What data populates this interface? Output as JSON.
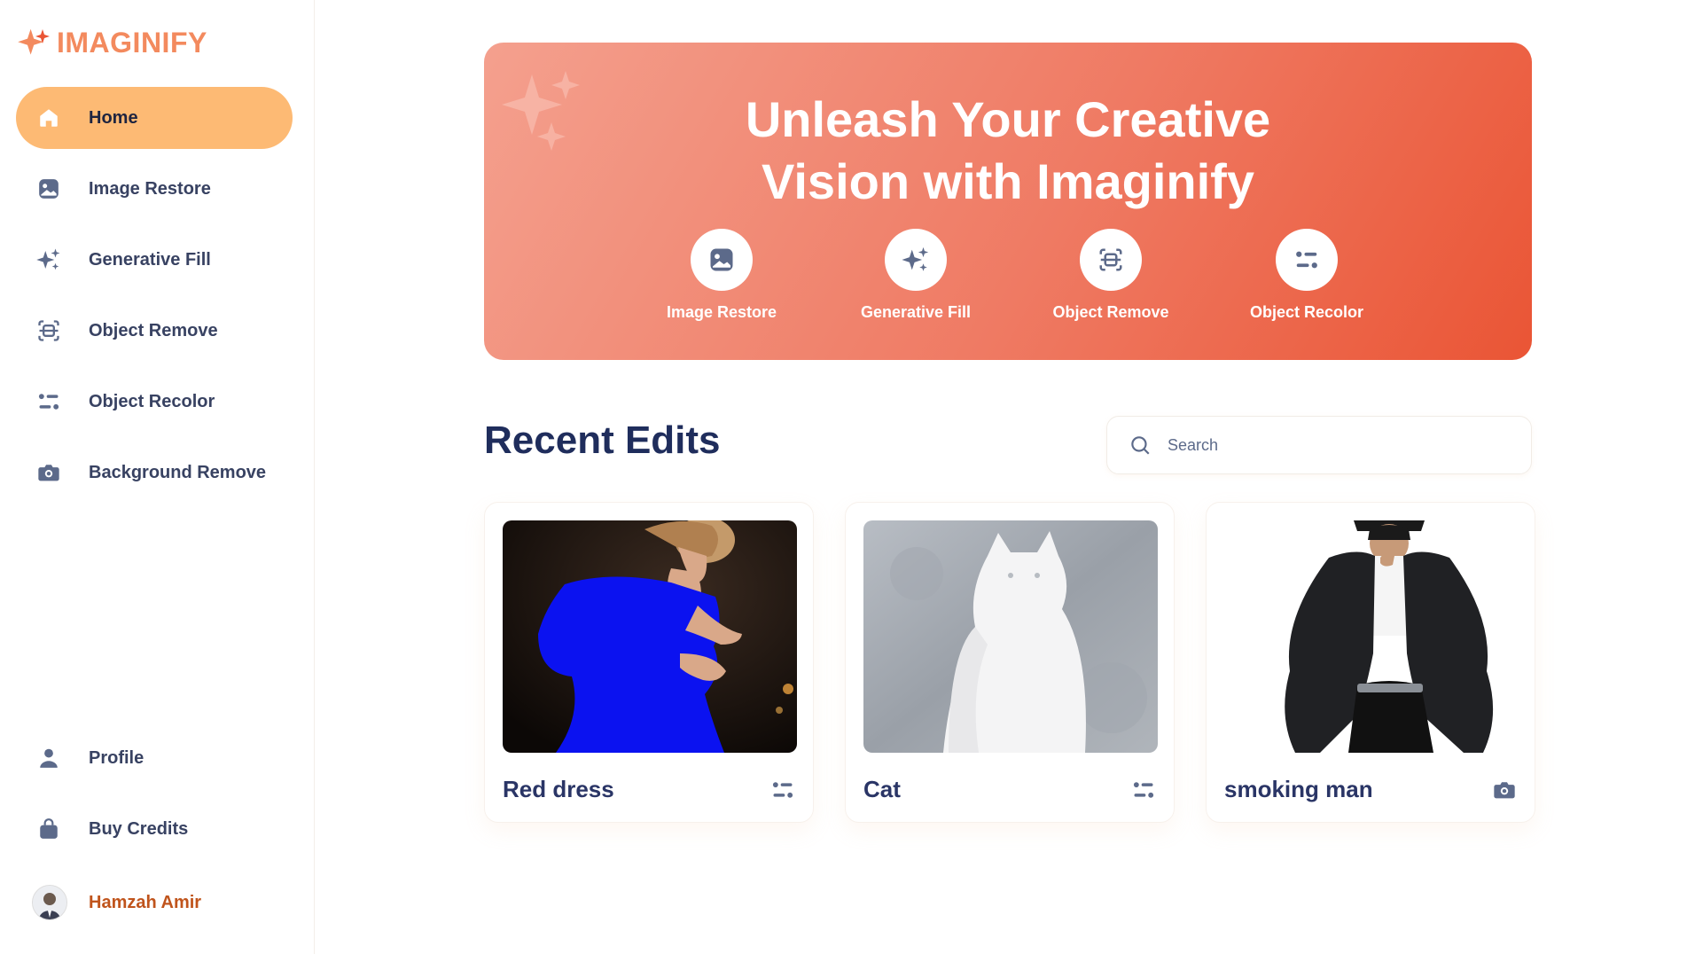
{
  "app": {
    "name": "IMAGINIFY",
    "brand_color": "#F38A5E",
    "accent_color": "#FDBA74"
  },
  "sidebar": {
    "items": [
      {
        "label": "Home",
        "icon": "home-icon",
        "active": true
      },
      {
        "label": "Image Restore",
        "icon": "image-icon"
      },
      {
        "label": "Generative Fill",
        "icon": "stars-icon"
      },
      {
        "label": "Object Remove",
        "icon": "scan-icon"
      },
      {
        "label": "Object Recolor",
        "icon": "filter-icon"
      },
      {
        "label": "Background Remove",
        "icon": "camera-icon"
      }
    ],
    "bottom_items": [
      {
        "label": "Profile",
        "icon": "user-icon"
      },
      {
        "label": "Buy Credits",
        "icon": "bag-icon"
      }
    ],
    "user": {
      "name": "Hamzah Amir"
    }
  },
  "hero": {
    "title": "Unleash Your Creative\nVision with Imaginify",
    "actions": [
      {
        "label": "Image Restore",
        "icon": "image-icon"
      },
      {
        "label": "Generative Fill",
        "icon": "stars-icon"
      },
      {
        "label": "Object Remove",
        "icon": "scan-icon"
      },
      {
        "label": "Object Recolor",
        "icon": "filter-icon"
      }
    ]
  },
  "recent": {
    "title": "Recent Edits",
    "search_placeholder": "Search",
    "cards": [
      {
        "title": "Red dress",
        "icon": "filter-icon"
      },
      {
        "title": "Cat",
        "icon": "filter-icon"
      },
      {
        "title": "smoking man",
        "icon": "camera-icon"
      }
    ]
  }
}
